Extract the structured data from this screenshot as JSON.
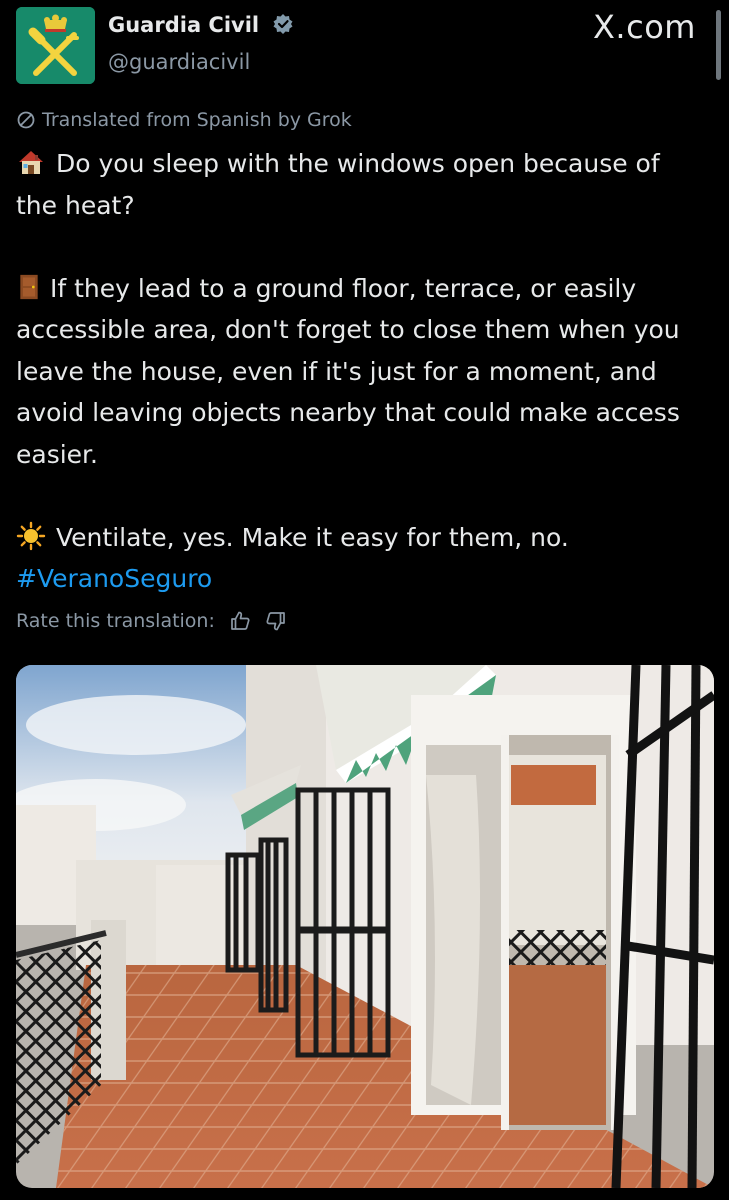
{
  "site": {
    "label": "X.com"
  },
  "author": {
    "name": "Guardia Civil",
    "handle": "@guardiacivil",
    "verified": true,
    "avatar_icon": "guardia-civil-emblem-icon",
    "avatar_color": "#178a6a"
  },
  "translation": {
    "note": "Translated from Spanish by Grok",
    "rate_label": "Rate this translation:"
  },
  "post": {
    "line1": "Do you sleep with the windows open because of the heat?",
    "line2": "If they lead to a ground floor, terrace, or easily accessible area, don't forget to close them when you leave the house, even if it's just for a moment, and avoid leaving objects nearby that could make access easier.",
    "line3": "Ventilate, yes. Make it easy for them, no.",
    "hashtag": "#VeranoSeguro",
    "emoji_icons": [
      "house-emoji-icon",
      "door-emoji-icon",
      "sun-emoji-icon"
    ]
  },
  "media": {
    "image_icon": "terrace-photo-image"
  },
  "colors": {
    "accent": "#1d9bf0",
    "muted": "#8b98a5",
    "text": "#e7e9ea",
    "background": "#000000"
  }
}
